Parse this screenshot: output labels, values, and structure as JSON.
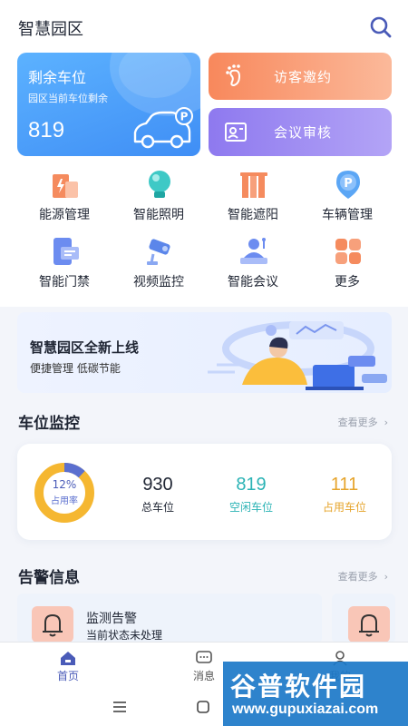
{
  "header": {
    "title": "智慧园区",
    "search_icon": "search-icon"
  },
  "parking_card": {
    "title": "剩余车位",
    "subtitle": "园区当前车位剩余",
    "count": "819",
    "icon": "car-parking-icon"
  },
  "quick_cards": [
    {
      "label": "访客邀约",
      "icon": "footprint-icon"
    },
    {
      "label": "会议审核",
      "icon": "meeting-badge-icon"
    }
  ],
  "functions": [
    {
      "label": "能源管理",
      "icon": "energy-building-icon"
    },
    {
      "label": "智能照明",
      "icon": "bulb-icon"
    },
    {
      "label": "智能遮阳",
      "icon": "blinds-icon"
    },
    {
      "label": "车辆管理",
      "icon": "parking-pin-icon"
    },
    {
      "label": "智能门禁",
      "icon": "access-card-icon"
    },
    {
      "label": "视频监控",
      "icon": "camera-icon"
    },
    {
      "label": "智能会议",
      "icon": "conference-icon"
    },
    {
      "label": "更多",
      "icon": "grid-more-icon"
    }
  ],
  "banner": {
    "title": "智慧园区全新上线",
    "subtitle": "便捷管理 低碳节能"
  },
  "parking_monitor": {
    "title": "车位监控",
    "more": "查看更多",
    "occupancy_pct": "12%",
    "occupancy_fraction": 0.12,
    "occupancy_label": "占用率",
    "stats": [
      {
        "value": "930",
        "label": "总车位",
        "color": "#1f2533"
      },
      {
        "value": "819",
        "label": "空闲车位",
        "color": "#2bb3b5"
      },
      {
        "value": "111",
        "label": "占用车位",
        "color": "#e6a42b"
      }
    ]
  },
  "alarms": {
    "title": "告警信息",
    "more": "查看更多",
    "items": [
      {
        "title": "监测告警",
        "status": "当前状态未处理"
      }
    ]
  },
  "tabbar": [
    {
      "label": "首页",
      "icon": "home-icon",
      "active": true
    },
    {
      "label": "消息",
      "icon": "message-icon",
      "active": false
    },
    {
      "label": "我的",
      "icon": "user-icon",
      "active": false
    }
  ],
  "watermark": {
    "title": "谷普软件园",
    "url": "www.gupuxiazai.com"
  },
  "colors": {
    "primary": "#3f8ef5",
    "accent_orange": "#f8885c",
    "accent_purple": "#8e79ef",
    "donut_track": "#f5b731",
    "donut_fill": "#5b6fcf"
  }
}
